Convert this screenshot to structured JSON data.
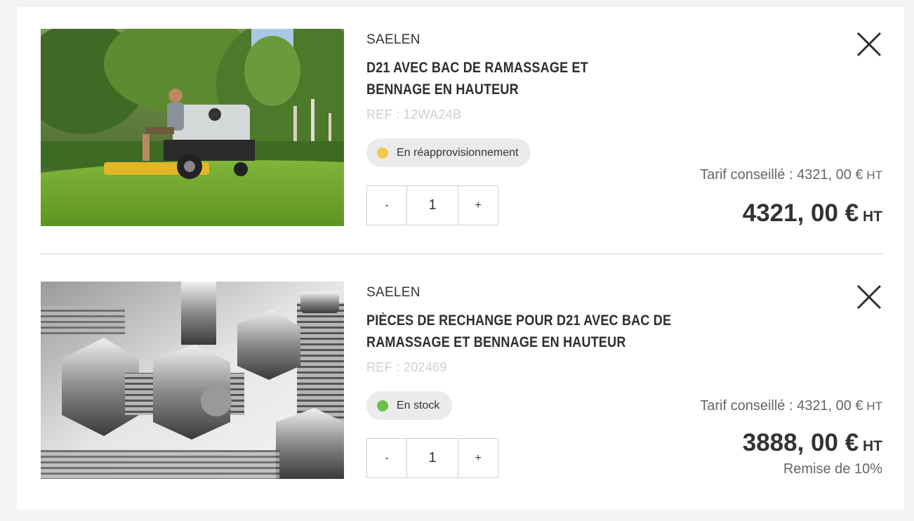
{
  "items": [
    {
      "brand": "SAELEN",
      "title_line1": "D21 AVEC BAC DE RAMASSAGE ET",
      "title_line2": "BENNAGE EN HAUTEUR",
      "ref": "REF : 12WA24B",
      "stock_label": "En réapprovisionnement",
      "stock_color": "#f2c94c",
      "qty_minus": "-",
      "qty_value": "1",
      "qty_plus": "+",
      "tarif_label": "Tarif conseillé : 4321, 00 €",
      "tarif_unit": " HT",
      "price": "4321, 00 €",
      "price_unit": " HT",
      "image_icon": "lawn-mower-photo"
    },
    {
      "brand": "SAELEN",
      "title_line1": "PIÈCES DE RECHANGE POUR D21 AVEC BAC DE",
      "title_line2": "RAMASSAGE ET BENNAGE EN HAUTEUR",
      "ref": "REF : 202469",
      "stock_label": "En stock",
      "stock_color": "#6cc04a",
      "qty_minus": "-",
      "qty_value": "1",
      "qty_plus": "+",
      "tarif_label": "Tarif conseillé : 4321, 00 €",
      "tarif_unit": " HT",
      "price": "3888, 00 €",
      "price_unit": " HT",
      "discount": "Remise de 10%",
      "image_icon": "bolts-photo"
    }
  ],
  "icons": {
    "close": "close-icon"
  }
}
